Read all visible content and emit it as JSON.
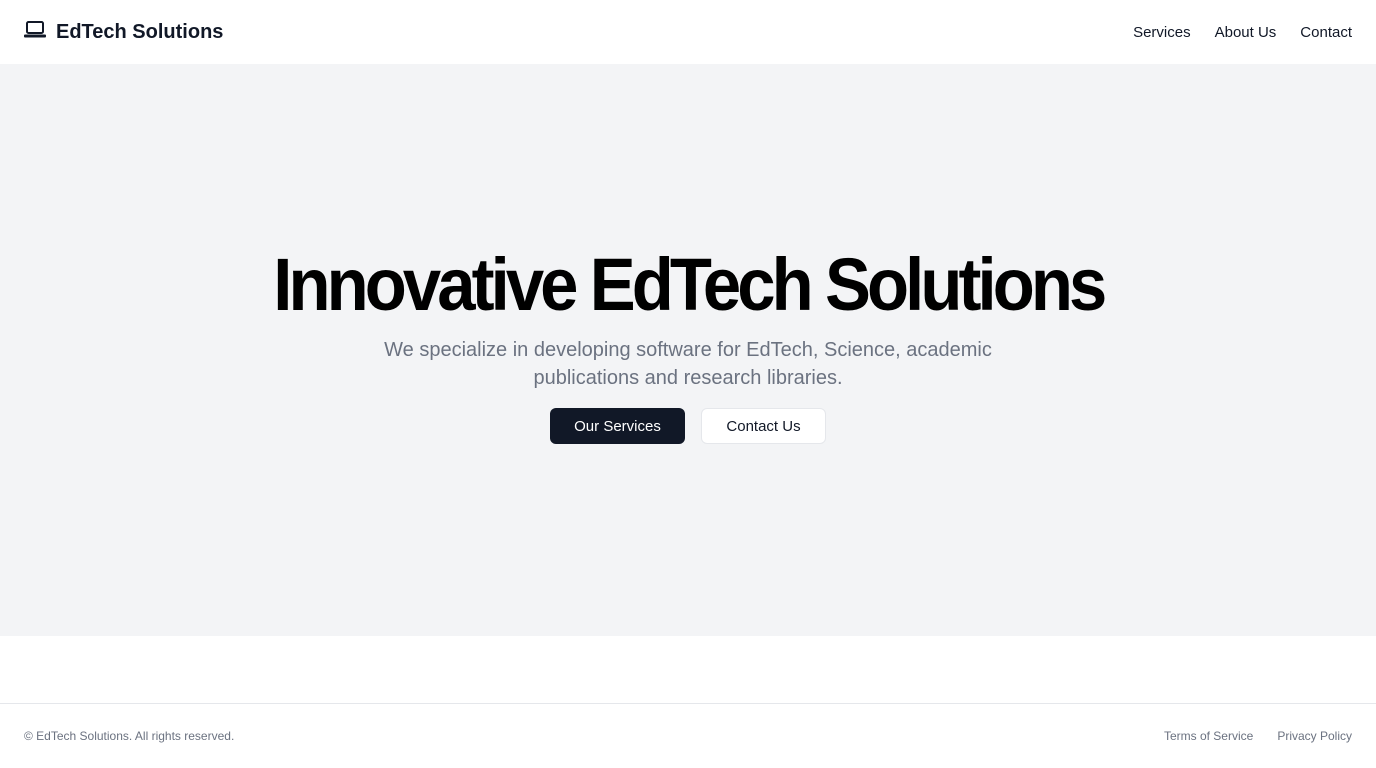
{
  "header": {
    "brand": "EdTech Solutions",
    "brand_icon": "laptop-icon",
    "nav": [
      {
        "label": "Services"
      },
      {
        "label": "About Us"
      },
      {
        "label": "Contact"
      }
    ]
  },
  "hero": {
    "title": "Innovative EdTech Solutions",
    "subtitle": "We specialize in developing software for EdTech, Science, academic publications and research libraries.",
    "primary_button": "Our Services",
    "secondary_button": "Contact Us"
  },
  "footer": {
    "copyright": "© EdTech Solutions. All rights reserved.",
    "links": [
      {
        "label": "Terms of Service"
      },
      {
        "label": "Privacy Policy"
      }
    ]
  }
}
